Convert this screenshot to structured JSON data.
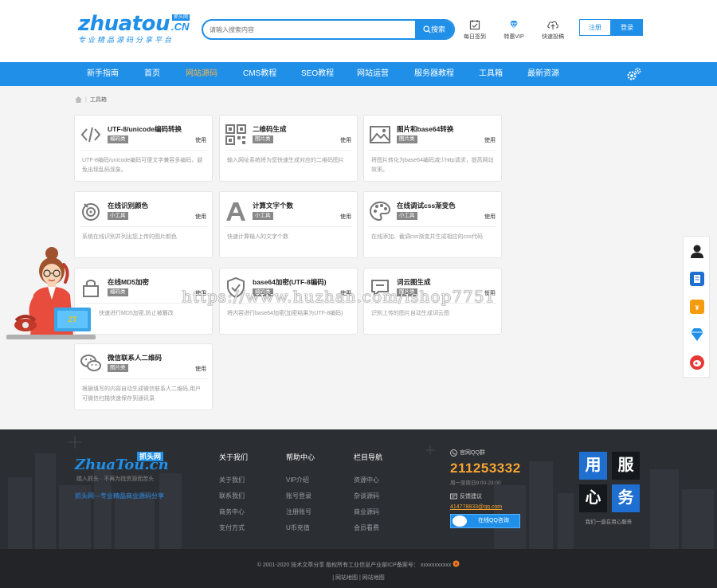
{
  "header": {
    "logo_text": "zhuatou",
    "logo_domain": ".CN",
    "logo_badge": "抓头网",
    "logo_slogan": "专业精品源码分享平台",
    "search_placeholder": "请输入搜索内容",
    "search_button": "搜索",
    "icons": [
      {
        "label": "每日签到",
        "icon": "checkin-icon"
      },
      {
        "label": "特惠VIP",
        "icon": "diamond-icon"
      },
      {
        "label": "快速投稿",
        "icon": "upload-cloud-icon"
      }
    ],
    "register": "注册",
    "login": "登录"
  },
  "nav": {
    "items": [
      "新手指南",
      "首页",
      "网站源码",
      "CMS教程",
      "SEO教程",
      "网站运营",
      "服务器教程",
      "工具箱",
      "最新资源"
    ],
    "active_index": 2,
    "accent": "#1f8fe8",
    "active_color": "#f7b54a"
  },
  "breadcrumb": {
    "current": "工具箱"
  },
  "tools": [
    {
      "title": "UTF-8/unicode编码转换",
      "tag": "编码类",
      "use": "使用",
      "desc": "UTF-8编码/unicode编码可便文字兼容多编码，避免出现乱码现象。",
      "icon": "code-icon"
    },
    {
      "title": "二维码生成",
      "tag": "图片类",
      "use": "使用",
      "desc": "输入网址系统将为您快速生成对应的二维码图片",
      "icon": "qrcode-icon"
    },
    {
      "title": "图片和base64转换",
      "tag": "图片类",
      "use": "使用",
      "desc": "将图片转化为base64编码减少http请求，提高网站效率。",
      "icon": "image-icon"
    },
    {
      "title": "在线识别颜色",
      "tag": "小工具",
      "use": "使用",
      "desc": "系统在线识别并列出您上传的图片颜色",
      "icon": "color-pick-icon"
    },
    {
      "title": "计算文字个数",
      "tag": "小工具",
      "use": "使用",
      "desc": "快速计算输入的文字个数",
      "icon": "letter-a-icon"
    },
    {
      "title": "在线调试css渐变色",
      "tag": "小工具",
      "use": "使用",
      "desc": "在线添加、截调css渐变并生成相应的css代码",
      "icon": "palette-icon"
    },
    {
      "title": "在线MD5加密",
      "tag": "编码类",
      "use": "使用",
      "desc": "快速进行MD5加密,防止被篡改",
      "icon": "lock-icon"
    },
    {
      "title": "base64加密(UTF-8编码)",
      "tag": "编码类",
      "use": "使用",
      "desc": "将内容进行base64加密(加密结果为UTF-8编码)",
      "icon": "shield-check-icon"
    },
    {
      "title": "词云图生成",
      "tag": "图片类",
      "use": "使用",
      "desc": "识别上传的图片自动生成词云图",
      "icon": "chat-bubble-icon"
    },
    {
      "title": "微信联系人二维码",
      "tag": "图片类",
      "use": "使用",
      "desc": "根据填写的内容自动生成微信联系人二维码,用户可微信扫描快速保存到通讯录",
      "icon": "wechat-icon"
    }
  ],
  "watermark": "https://www.huzhan.com/ishop7751",
  "service_box": {
    "logo": "ZT"
  },
  "float_bar": [
    "user-service-icon",
    "doc-icon",
    "vip-badge-icon",
    "diamond-icon",
    "weibo-icon"
  ],
  "footer": {
    "logo_text": "ZhuaTou.cn",
    "logo_badge": "抓头网",
    "logo_sub": "踏入抓头 · 不再为找资源而苦头",
    "slogan": "抓头网---专业精品商业源码分享",
    "columns": [
      {
        "title": "关于我们",
        "links": [
          "关于我们",
          "联系我们",
          "商务中心",
          "支付方式"
        ]
      },
      {
        "title": "帮助中心",
        "links": [
          "VIP介绍",
          "账号登录",
          "注册账号",
          "U币充值"
        ]
      },
      {
        "title": "栏目导航",
        "links": [
          "资源中心",
          "杂谈源码",
          "商业源码",
          "会员看费"
        ]
      }
    ],
    "qq_label": "官网QQ群",
    "qq_number": "211253332",
    "qq_time": "周一至周日9:00-23:00",
    "feedback_label": "反馈建议",
    "email": "414778833@qq.com",
    "qq_button": "在线QQ咨询",
    "serve_chars": [
      "用",
      "服",
      "心",
      "务"
    ],
    "serve_caption": "我们一直在用心服务",
    "copyright": "© 2001-2020 技术文章分享 版权所有工业信息产业部ICP备案号：",
    "icp": "xxxxxxxxxxx",
    "bottom_links": [
      "网站地图",
      "网站地图"
    ]
  }
}
